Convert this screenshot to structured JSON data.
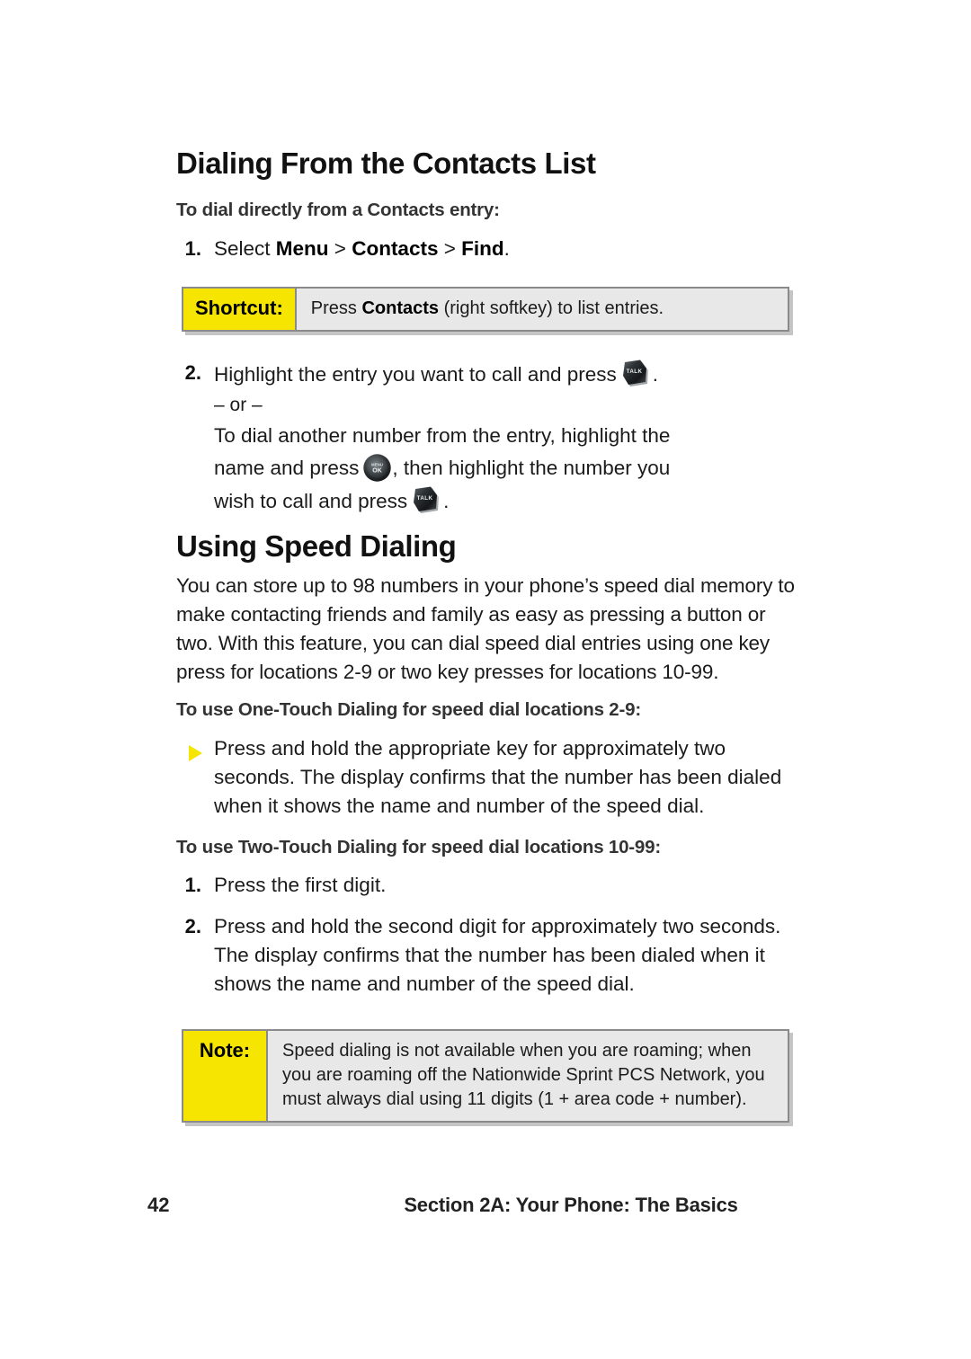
{
  "page": {
    "folio": "42",
    "running_head": "Section 2A: Your Phone: The Basics"
  },
  "colors": {
    "callout_label_bg": "#F5E500",
    "callout_body_bg": "#E8E8E8",
    "callout_border": "#8A8A8A",
    "bullet_triangle": "#F5E500",
    "text": "#1B1B1B"
  },
  "section_one": {
    "title": "Dialing From the Contacts List",
    "subhead": "To dial directly from a Contacts entry:",
    "step1": {
      "number": "1.",
      "prefix": "Select ",
      "menu": "Menu",
      "sep1": " > ",
      "contacts": "Contacts",
      "sep2": " > ",
      "find": "Find",
      "suffix": "."
    },
    "shortcut": {
      "label": "Shortcut:",
      "text_prefix": "Press ",
      "text_bold": "Contacts",
      "text_suffix": " (right softkey) to list entries."
    },
    "step2": {
      "number": "2.",
      "line1_prefix": "Highlight the entry you want to call and press",
      "line1_suffix": ".",
      "or_line": "– or –",
      "line2": "To dial another number from the entry, highlight the",
      "line3_prefix": "name and press",
      "line3_suffix": ", then highlight the number you",
      "line4_prefix": "wish to call and press",
      "line4_suffix": "."
    },
    "keys": {
      "talk": "talk-key-icon",
      "talk_label": "TALK",
      "ok": "menu-ok-key-icon",
      "ok_label_top": "MENU",
      "ok_label_bottom": "OK"
    }
  },
  "section_two": {
    "title": "Using Speed Dialing",
    "paragraph": "You can store up to 98 numbers in your phone’s speed dial memory to make contacting friends and family as easy as pressing a button or two. With this feature, you can dial speed dial entries using one key press for locations 2-9 or two key presses for locations 10-99.",
    "one_touch": {
      "subhead": "To use One-Touch Dialing for speed dial locations 2-9:",
      "bullet": "Press and hold the appropriate key for approximately two seconds. The display confirms that the number has been dialed when it shows the name and number of the speed dial."
    },
    "two_touch": {
      "subhead": "To use Two-Touch Dialing for speed dial locations 10-99:",
      "steps": [
        {
          "number": "1.",
          "text": "Press the first digit."
        },
        {
          "number": "2.",
          "text": "Press and hold the second digit for approximately two seconds. The display confirms that the number has been dialed when it shows the name and number of the speed dial."
        }
      ]
    },
    "note": {
      "label": "Note:",
      "line1": "Speed dialing is not available when you are roaming; when",
      "line2": "you are roaming off the Nationwide Sprint PCS Network, you",
      "line3": "must always dial using 11 digits (1 + area code + number)."
    }
  }
}
